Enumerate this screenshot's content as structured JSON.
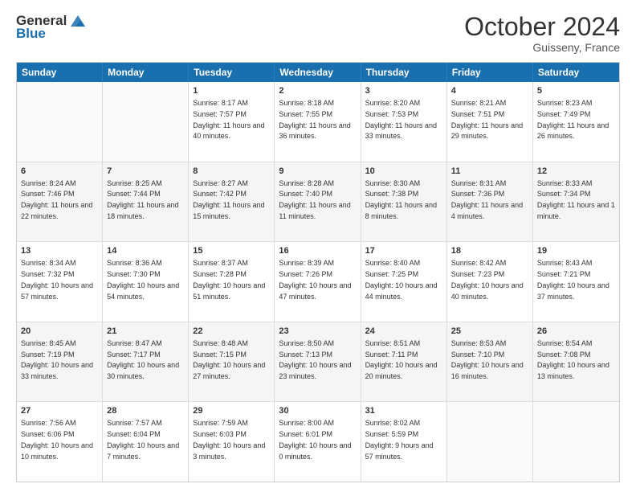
{
  "header": {
    "logo_line1": "General",
    "logo_line2": "Blue",
    "month": "October 2024",
    "location": "Guisseny, France"
  },
  "days_of_week": [
    "Sunday",
    "Monday",
    "Tuesday",
    "Wednesday",
    "Thursday",
    "Friday",
    "Saturday"
  ],
  "rows": [
    [
      {
        "day": "",
        "sunrise": "",
        "sunset": "",
        "daylight": "",
        "empty": true
      },
      {
        "day": "",
        "sunrise": "",
        "sunset": "",
        "daylight": "",
        "empty": true
      },
      {
        "day": "1",
        "sunrise": "Sunrise: 8:17 AM",
        "sunset": "Sunset: 7:57 PM",
        "daylight": "Daylight: 11 hours and 40 minutes."
      },
      {
        "day": "2",
        "sunrise": "Sunrise: 8:18 AM",
        "sunset": "Sunset: 7:55 PM",
        "daylight": "Daylight: 11 hours and 36 minutes."
      },
      {
        "day": "3",
        "sunrise": "Sunrise: 8:20 AM",
        "sunset": "Sunset: 7:53 PM",
        "daylight": "Daylight: 11 hours and 33 minutes."
      },
      {
        "day": "4",
        "sunrise": "Sunrise: 8:21 AM",
        "sunset": "Sunset: 7:51 PM",
        "daylight": "Daylight: 11 hours and 29 minutes."
      },
      {
        "day": "5",
        "sunrise": "Sunrise: 8:23 AM",
        "sunset": "Sunset: 7:49 PM",
        "daylight": "Daylight: 11 hours and 26 minutes."
      }
    ],
    [
      {
        "day": "6",
        "sunrise": "Sunrise: 8:24 AM",
        "sunset": "Sunset: 7:46 PM",
        "daylight": "Daylight: 11 hours and 22 minutes."
      },
      {
        "day": "7",
        "sunrise": "Sunrise: 8:25 AM",
        "sunset": "Sunset: 7:44 PM",
        "daylight": "Daylight: 11 hours and 18 minutes."
      },
      {
        "day": "8",
        "sunrise": "Sunrise: 8:27 AM",
        "sunset": "Sunset: 7:42 PM",
        "daylight": "Daylight: 11 hours and 15 minutes."
      },
      {
        "day": "9",
        "sunrise": "Sunrise: 8:28 AM",
        "sunset": "Sunset: 7:40 PM",
        "daylight": "Daylight: 11 hours and 11 minutes."
      },
      {
        "day": "10",
        "sunrise": "Sunrise: 8:30 AM",
        "sunset": "Sunset: 7:38 PM",
        "daylight": "Daylight: 11 hours and 8 minutes."
      },
      {
        "day": "11",
        "sunrise": "Sunrise: 8:31 AM",
        "sunset": "Sunset: 7:36 PM",
        "daylight": "Daylight: 11 hours and 4 minutes."
      },
      {
        "day": "12",
        "sunrise": "Sunrise: 8:33 AM",
        "sunset": "Sunset: 7:34 PM",
        "daylight": "Daylight: 11 hours and 1 minute."
      }
    ],
    [
      {
        "day": "13",
        "sunrise": "Sunrise: 8:34 AM",
        "sunset": "Sunset: 7:32 PM",
        "daylight": "Daylight: 10 hours and 57 minutes."
      },
      {
        "day": "14",
        "sunrise": "Sunrise: 8:36 AM",
        "sunset": "Sunset: 7:30 PM",
        "daylight": "Daylight: 10 hours and 54 minutes."
      },
      {
        "day": "15",
        "sunrise": "Sunrise: 8:37 AM",
        "sunset": "Sunset: 7:28 PM",
        "daylight": "Daylight: 10 hours and 51 minutes."
      },
      {
        "day": "16",
        "sunrise": "Sunrise: 8:39 AM",
        "sunset": "Sunset: 7:26 PM",
        "daylight": "Daylight: 10 hours and 47 minutes."
      },
      {
        "day": "17",
        "sunrise": "Sunrise: 8:40 AM",
        "sunset": "Sunset: 7:25 PM",
        "daylight": "Daylight: 10 hours and 44 minutes."
      },
      {
        "day": "18",
        "sunrise": "Sunrise: 8:42 AM",
        "sunset": "Sunset: 7:23 PM",
        "daylight": "Daylight: 10 hours and 40 minutes."
      },
      {
        "day": "19",
        "sunrise": "Sunrise: 8:43 AM",
        "sunset": "Sunset: 7:21 PM",
        "daylight": "Daylight: 10 hours and 37 minutes."
      }
    ],
    [
      {
        "day": "20",
        "sunrise": "Sunrise: 8:45 AM",
        "sunset": "Sunset: 7:19 PM",
        "daylight": "Daylight: 10 hours and 33 minutes."
      },
      {
        "day": "21",
        "sunrise": "Sunrise: 8:47 AM",
        "sunset": "Sunset: 7:17 PM",
        "daylight": "Daylight: 10 hours and 30 minutes."
      },
      {
        "day": "22",
        "sunrise": "Sunrise: 8:48 AM",
        "sunset": "Sunset: 7:15 PM",
        "daylight": "Daylight: 10 hours and 27 minutes."
      },
      {
        "day": "23",
        "sunrise": "Sunrise: 8:50 AM",
        "sunset": "Sunset: 7:13 PM",
        "daylight": "Daylight: 10 hours and 23 minutes."
      },
      {
        "day": "24",
        "sunrise": "Sunrise: 8:51 AM",
        "sunset": "Sunset: 7:11 PM",
        "daylight": "Daylight: 10 hours and 20 minutes."
      },
      {
        "day": "25",
        "sunrise": "Sunrise: 8:53 AM",
        "sunset": "Sunset: 7:10 PM",
        "daylight": "Daylight: 10 hours and 16 minutes."
      },
      {
        "day": "26",
        "sunrise": "Sunrise: 8:54 AM",
        "sunset": "Sunset: 7:08 PM",
        "daylight": "Daylight: 10 hours and 13 minutes."
      }
    ],
    [
      {
        "day": "27",
        "sunrise": "Sunrise: 7:56 AM",
        "sunset": "Sunset: 6:06 PM",
        "daylight": "Daylight: 10 hours and 10 minutes."
      },
      {
        "day": "28",
        "sunrise": "Sunrise: 7:57 AM",
        "sunset": "Sunset: 6:04 PM",
        "daylight": "Daylight: 10 hours and 7 minutes."
      },
      {
        "day": "29",
        "sunrise": "Sunrise: 7:59 AM",
        "sunset": "Sunset: 6:03 PM",
        "daylight": "Daylight: 10 hours and 3 minutes."
      },
      {
        "day": "30",
        "sunrise": "Sunrise: 8:00 AM",
        "sunset": "Sunset: 6:01 PM",
        "daylight": "Daylight: 10 hours and 0 minutes."
      },
      {
        "day": "31",
        "sunrise": "Sunrise: 8:02 AM",
        "sunset": "Sunset: 5:59 PM",
        "daylight": "Daylight: 9 hours and 57 minutes."
      },
      {
        "day": "",
        "sunrise": "",
        "sunset": "",
        "daylight": "",
        "empty": true
      },
      {
        "day": "",
        "sunrise": "",
        "sunset": "",
        "daylight": "",
        "empty": true
      }
    ]
  ]
}
